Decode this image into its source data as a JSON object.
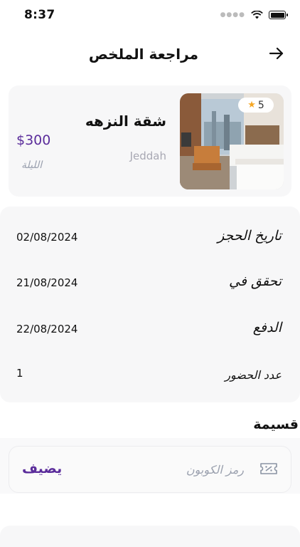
{
  "status_bar": {
    "time": "8:37"
  },
  "header": {
    "title": "مراجعة الملخص"
  },
  "hotel": {
    "rating": "5",
    "name": "شقة النزهه",
    "price": "$300",
    "city": "Jeddah",
    "per_night": "الليلة"
  },
  "details": [
    {
      "label": "تاريخ الحجز",
      "value": "02/08/2024"
    },
    {
      "label": "تحقق في",
      "value": "21/08/2024"
    },
    {
      "label": "الدفع",
      "value": "22/08/2024"
    },
    {
      "label": "عدد الحضور",
      "value": "1"
    }
  ],
  "coupon": {
    "title": "قسيمة",
    "placeholder": "رمز الكوبون",
    "add_label": "يضيف"
  },
  "colors": {
    "accent": "#5b2d9b",
    "card_bg": "#f7f7f8",
    "star": "#f5a623"
  }
}
